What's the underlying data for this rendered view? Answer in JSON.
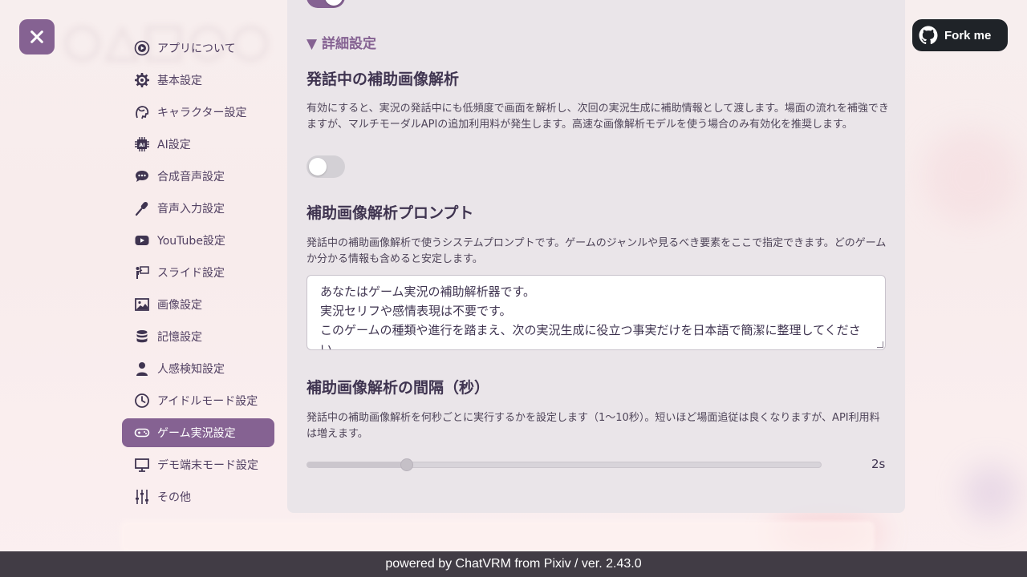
{
  "window": {
    "close_icon": "close-icon",
    "fork_label": "Fork me",
    "fork_icon": "github-icon"
  },
  "sidebar": {
    "items": [
      {
        "label": "アプリについて",
        "icon": "play-circle-icon",
        "active": false
      },
      {
        "label": "基本設定",
        "icon": "gear-icon",
        "active": false
      },
      {
        "label": "キャラクター設定",
        "icon": "character-icon",
        "active": false
      },
      {
        "label": "AI設定",
        "icon": "ai-chip-icon",
        "active": false
      },
      {
        "label": "合成音声設定",
        "icon": "speech-bubble-icon",
        "active": false
      },
      {
        "label": "音声入力設定",
        "icon": "microphone-icon",
        "active": false
      },
      {
        "label": "YouTube設定",
        "icon": "youtube-icon",
        "active": false
      },
      {
        "label": "スライド設定",
        "icon": "presenter-icon",
        "active": false
      },
      {
        "label": "画像設定",
        "icon": "image-icon",
        "active": false
      },
      {
        "label": "記憶設定",
        "icon": "database-icon",
        "active": false
      },
      {
        "label": "人感検知設定",
        "icon": "person-icon",
        "active": false
      },
      {
        "label": "アイドルモード設定",
        "icon": "clock-icon",
        "active": false
      },
      {
        "label": "ゲーム実況設定",
        "icon": "gamepad-icon",
        "active": true
      },
      {
        "label": "デモ端末モード設定",
        "icon": "monitor-icon",
        "active": false
      },
      {
        "label": "その他",
        "icon": "sliders-icon",
        "active": false
      }
    ]
  },
  "panel": {
    "top_toggle_on": true,
    "detail_header": "▼ 詳細設定",
    "assist": {
      "title": "発話中の補助画像解析",
      "description": "有効にすると、実況の発話中にも低頻度で画面を解析し、次回の実況生成に補助情報として渡します。場面の流れを補強できますが、マルチモーダルAPIの追加利用料が発生します。高速な画像解析モデルを使う場合のみ有効化を推奨します。",
      "enabled": false
    },
    "prompt": {
      "title": "補助画像解析プロンプト",
      "description": "発話中の補助画像解析で使うシステムプロンプトです。ゲームのジャンルや見るべき要素をここで指定できます。どのゲームか分かる情報も含めると安定します。",
      "value": "あなたはゲーム実況の補助解析器です。\n実況セリフや感情表現は不要です。\nこのゲームの種類や進行を踏まえ、次の実況生成に役立つ事実だけを日本語で簡潔に整理してください。"
    },
    "interval": {
      "title": "補助画像解析の間隔（秒）",
      "description": "発話中の補助画像解析を何秒ごとに実行するかを設定します（1〜10秒）。短いほど場面追従は良くなりますが、API利用料は増えます。",
      "min": 1,
      "max": 10,
      "value": 2,
      "value_label": "2s"
    }
  },
  "footer": {
    "text": "powered by ChatVRM from Pixiv / ver. 2.43.0"
  }
}
